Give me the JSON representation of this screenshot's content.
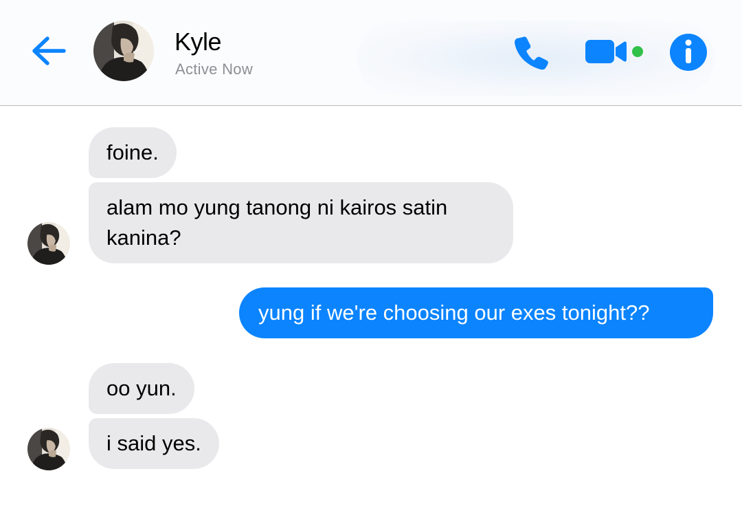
{
  "header": {
    "contact_name": "Kyle",
    "status": "Active Now",
    "back_icon": "arrow-left-icon",
    "call_icon": "phone-icon",
    "video_icon": "video-camera-icon",
    "info_icon": "info-icon",
    "presence_indicator_color": "#31c048"
  },
  "colors": {
    "accent": "#0b84fe",
    "incoming_bubble": "#e9e9eb",
    "outgoing_text": "#ffffff",
    "status_text": "#8e8e93"
  },
  "messages": [
    {
      "sender": "Kyle",
      "direction": "incoming",
      "text": "foine."
    },
    {
      "sender": "Kyle",
      "direction": "incoming",
      "text": "alam mo yung tanong ni kairos satin\nkanina?"
    },
    {
      "sender": "me",
      "direction": "outgoing",
      "text": "yung if we're choosing our exes tonight??"
    },
    {
      "sender": "Kyle",
      "direction": "incoming",
      "text": "oo yun."
    },
    {
      "sender": "Kyle",
      "direction": "incoming",
      "text": "i said yes."
    }
  ]
}
